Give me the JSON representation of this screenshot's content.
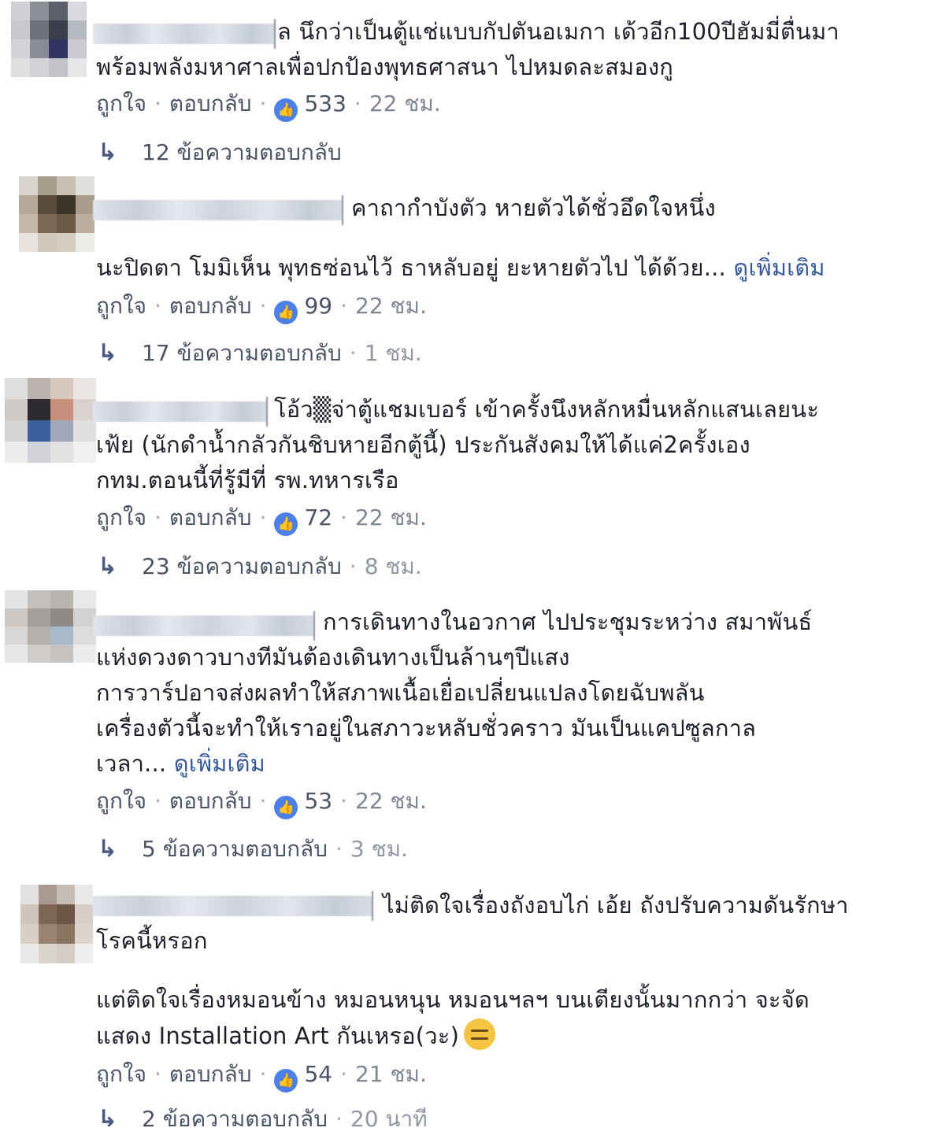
{
  "ui": {
    "like_label": "ถูกใจ",
    "reply_label": "ตอบกลับ",
    "sep": "·",
    "like_glyph": "👍"
  },
  "comments": [
    {
      "lines": [
        "ล นึกว่าเป็นตู้แช่แบบกัปตันอเมกา เด้วอีก100ปีฮัมมี่ตื่นมา",
        "พร้อมพลังมหาศาลเพื่อปกป้องพุทธศาสนา ไปหมดละสมองกู"
      ],
      "likes": "533",
      "time": "22 ชม.",
      "replies": "12 ข้อความตอบกลับ",
      "reply_time": ""
    },
    {
      "lines": [
        "คาถากำบังตัว หายตัวได้ชั่วอึดใจหนึ่ง",
        "นะปิดตา โมมิเห็น พุทธซ่อนไว้ ธาหลับอยู่ ยะหายตัวไป ได้ด้วย..."
      ],
      "see_more": "ดูเพิ่มเติม",
      "likes": "99",
      "time": "22 ชม.",
      "replies": "17 ข้อความตอบกลับ",
      "reply_time": "1 ชม."
    },
    {
      "lines": [
        "โอ้ว▒จ่าตู้แชมเบอร์ เข้าครั้งนึงหลักหมื่นหลักแสนเลยนะ",
        "เฟ้ย (นักดำน้ำกลัวกันชิบหายอีกตู้นี้) ประกันสังคมให้ได้แค่2ครั้งเอง",
        "กทม.ตอนนี้ที่รู้มีที่ รพ.ทหารเรือ"
      ],
      "likes": "72",
      "time": "22 ชม.",
      "replies": "23 ข้อความตอบกลับ",
      "reply_time": "8 ชม."
    },
    {
      "lines": [
        "การเดินทางในอวกาศ ไปประชุมระหว่าง สมาพันธ์",
        "แห่งดวงดาวบางทีมันต้องเดินทางเป็นล้านๆปีแสง",
        "การวาร์ปอาจส่งผลทำให้สภาพเนื้อเยื่อเปลี่ยนแปลงโดยฉับพลัน",
        "เครื่องตัวนี้จะทำให้เราอยู่ในสภาวะหลับชั่วคราว มันเป็นแคปซูลกาล",
        "เวลา..."
      ],
      "see_more": "ดูเพิ่มเติม",
      "likes": "53",
      "time": "22 ชม.",
      "replies": "5 ข้อความตอบกลับ",
      "reply_time": "3 ชม."
    },
    {
      "lines": [
        "ไม่ติดใจเรื่องถังอบไก่ เอ้ย ถังปรับความดันรักษา",
        "โรคนี้หรอก",
        "แต่ติดใจเรื่องหมอนข้าง หมอนหนุน หมอนฯลฯ บนเตียงนั้นมากกว่า จะจัด",
        "แสดง Installation Art กันเหรอ(วะ)"
      ],
      "likes": "54",
      "time": "21 ชม.",
      "replies": "2 ข้อความตอบกลับ",
      "reply_time": "20 นาที"
    }
  ]
}
